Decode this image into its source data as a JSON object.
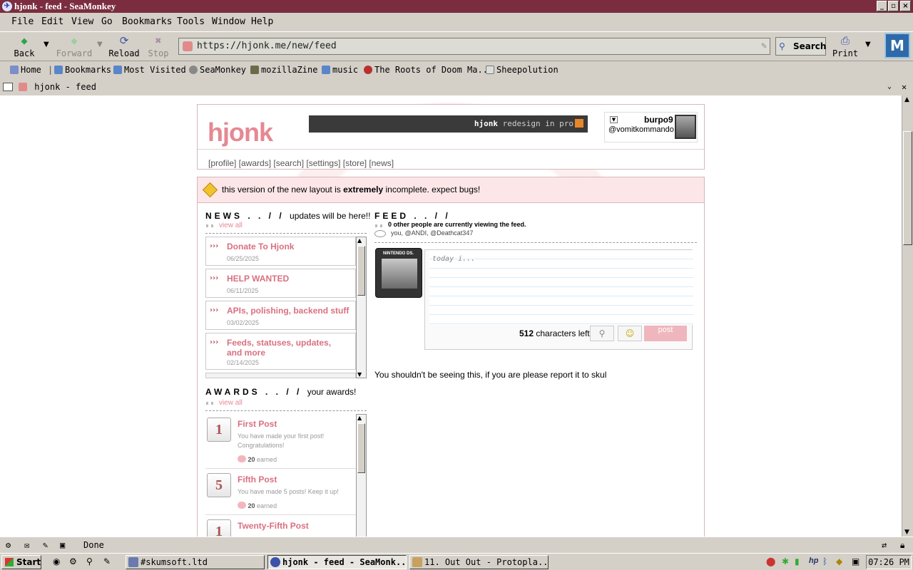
{
  "window": {
    "title": "hjonk - feed - SeaMonkey"
  },
  "menu": [
    "File",
    "Edit",
    "View",
    "Go",
    "Bookmarks",
    "Tools",
    "Window",
    "Help"
  ],
  "nav": {
    "back": "Back",
    "forward": "Forward",
    "reload": "Reload",
    "stop": "Stop",
    "search": "Search",
    "print": "Print"
  },
  "url": "https://hjonk.me/new/feed",
  "bookmarks": [
    "Home",
    "Bookmarks",
    "Most Visited",
    "SeaMonkey",
    "mozillaZine",
    "music",
    "The Roots of Doom Ma...",
    "Sheepolution"
  ],
  "tab": {
    "title": "hjonk - feed"
  },
  "page": {
    "brand": "hjonk",
    "ticker_user": "hjonk",
    "ticker_text": " redesign in pro",
    "user": {
      "name": "burpo9",
      "handle": "@vomitkommando"
    },
    "navlinks": "[profile] [awards] [search]  [settings] [store] [news]",
    "alert_pre": "this version of the new layout is ",
    "alert_bold": "extremely",
    "alert_post": " incomplete. expect bugs!",
    "news": {
      "title": "NEWS . . / /",
      "subtitle": "updates will be here!!",
      "view_all": "view all",
      "items": [
        {
          "title": "Donate To Hjonk",
          "date": "06/25/2025"
        },
        {
          "title": "HELP WANTED",
          "date": "06/11/2025"
        },
        {
          "title": "APIs, polishing, backend stuff",
          "date": "03/02/2025"
        },
        {
          "title": "Feeds, statuses, updates, and more",
          "date": "02/14/2025"
        }
      ]
    },
    "awards": {
      "title": "AWARDS . . / /",
      "subtitle": "your awards!",
      "view_all": "view all",
      "items": [
        {
          "title": "First Post",
          "desc": "You have made your first post! Congratulations!",
          "earned_count": "20",
          "earned_label": "earned",
          "badge": "1"
        },
        {
          "title": "Fifth Post",
          "desc": "You have made 5 posts! Keep it up!",
          "earned_count": "20",
          "earned_label": "earned",
          "badge": "5"
        },
        {
          "title": "Twenty-Fifth Post",
          "badge": "1"
        }
      ]
    },
    "feed": {
      "title": "FEED . . / /",
      "viewers": "0 other people are currently viewing the feed.",
      "viewer_list": "you, @ANDI, @Deathcat347",
      "placeholder": "today i...",
      "chars_count": "512",
      "chars_label": "characters left",
      "post": "post",
      "notice": "You shouldn't be seeing this, if you are please report it to skul",
      "cartridge_brand": "NINTENDO DS."
    }
  },
  "status": "Done",
  "taskbar": {
    "start": "Start",
    "tasks": [
      "#skumsoft.ltd",
      "hjonk - feed - SeaMonk...",
      "11. Out Out - Protopla..."
    ],
    "clock": "07:26 PM"
  }
}
